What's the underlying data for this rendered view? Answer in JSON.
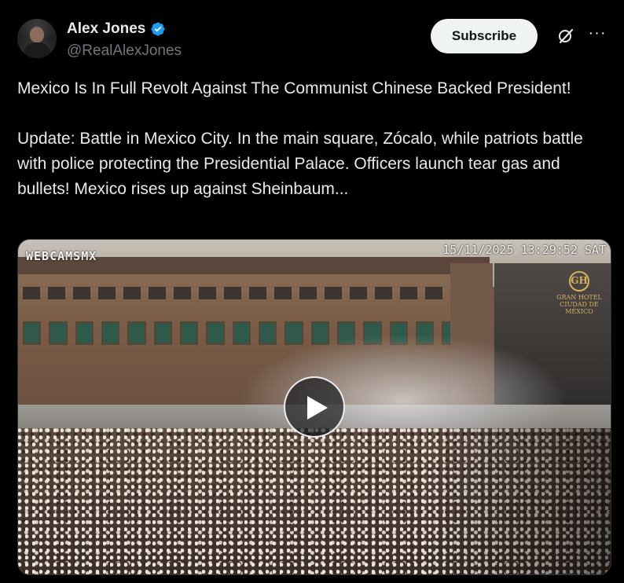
{
  "author": {
    "name": "Alex Jones",
    "handle": "@RealAlexJones",
    "verified": true
  },
  "actions": {
    "subscribe_label": "Subscribe",
    "grok_icon": "grok-icon",
    "more_icon": "more-icon",
    "more_glyph": "···"
  },
  "post": {
    "paragraph1": "Mexico Is In Full Revolt Against The Communist Chinese Backed President!",
    "paragraph2": "Update: Battle in Mexico City. In the main square, Zócalo, while patriots battle with police protecting the Presidential Palace. Officers launch tear gas and bullets! Mexico rises up against Sheinbaum..."
  },
  "media": {
    "watermark": "WEBCAMSMX",
    "timestamp": "15/11/2025 13:29:52 SAT",
    "hotel_logo_emblem": "GH",
    "hotel_logo_line1": "GRAN HOTEL",
    "hotel_logo_line2": "CIUDAD DE MÉXICO",
    "play_icon": "play-icon"
  },
  "colors": {
    "background": "#000000",
    "text": "#e7e9ea",
    "secondary_text": "#71767b",
    "verified_blue": "#1d9bf0",
    "subscribe_bg": "#eff3f4"
  }
}
